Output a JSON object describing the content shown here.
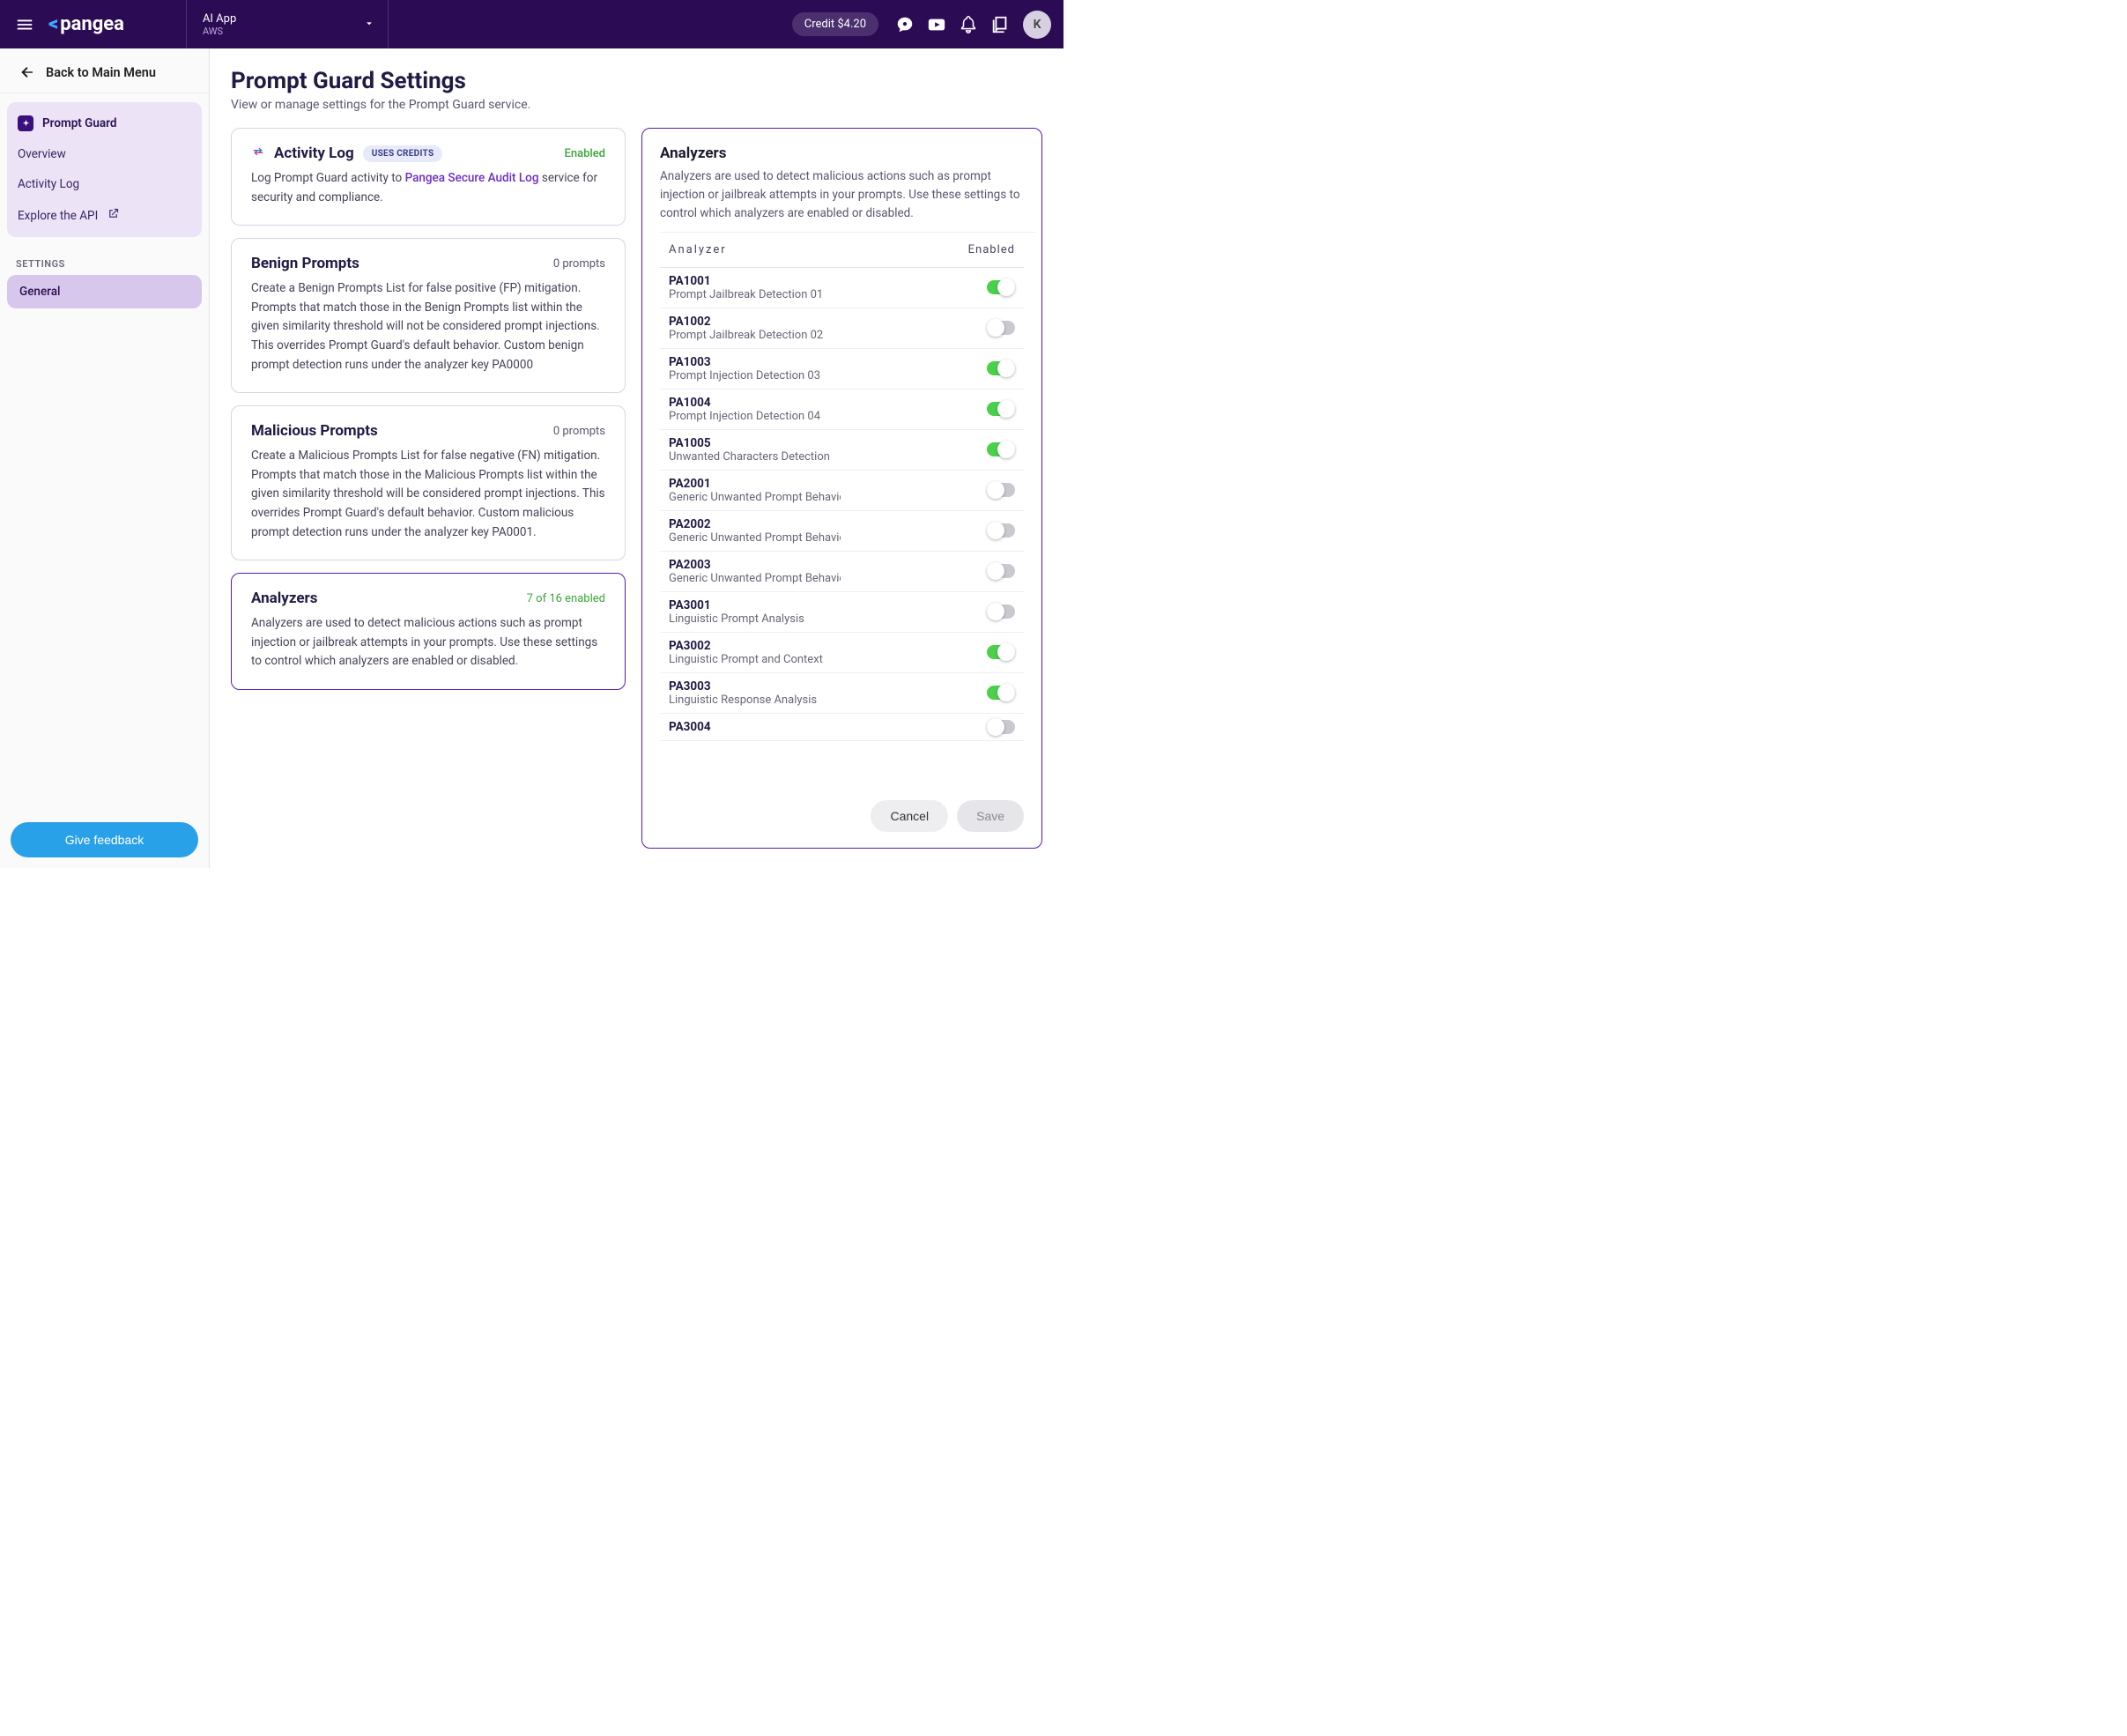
{
  "header": {
    "project_name": "AI App",
    "project_sub": "AWS",
    "credit": "Credit $4.20",
    "avatar": "K"
  },
  "sidebar": {
    "back": "Back to Main Menu",
    "group_header": "Prompt Guard",
    "items": [
      "Overview",
      "Activity Log",
      "Explore the API"
    ],
    "settings_label": "SETTINGS",
    "settings_item": "General",
    "feedback": "Give feedback"
  },
  "page": {
    "title": "Prompt Guard Settings",
    "subtitle": "View or manage settings for the Prompt Guard service."
  },
  "cards": {
    "activity": {
      "title": "Activity Log",
      "badge": "USES CREDITS",
      "status": "Enabled",
      "desc_pre": "Log Prompt Guard activity to ",
      "desc_link": "Pangea Secure Audit Log",
      "desc_post": " service for security and compliance."
    },
    "benign": {
      "title": "Benign Prompts",
      "count": "0 prompts",
      "desc": "Create a Benign Prompts List for false positive (FP) mitigation. Prompts that match those in the Benign Prompts list within the given similarity threshold will not be considered prompt injections. This overrides Prompt Guard's default behavior. Custom benign prompt detection runs under the analyzer key PA0000"
    },
    "malicious": {
      "title": "Malicious Prompts",
      "count": "0 prompts",
      "desc": "Create a Malicious Prompts List for false negative (FN) mitigation. Prompts that match those in the Malicious Prompts list within the given similarity threshold will be considered prompt injections. This overrides Prompt Guard's default behavior. Custom malicious prompt detection runs under the analyzer key PA0001."
    },
    "analyzers": {
      "title": "Analyzers",
      "count": "7 of 16 enabled",
      "desc": "Analyzers are used to detect malicious actions such as prompt injection or jailbreak attempts in your prompts. Use these settings to control which analyzers are enabled or disabled."
    }
  },
  "panel": {
    "title": "Analyzers",
    "desc": "Analyzers are used to detect malicious actions such as prompt injection or jailbreak attempts in your prompts. Use these settings to control which analyzers are enabled or disabled.",
    "col_a": "Analyzer",
    "col_b": "Enabled",
    "cancel": "Cancel",
    "save": "Save",
    "rows": [
      {
        "id": "PA1001",
        "name": "Prompt Jailbreak Detection 01",
        "on": true
      },
      {
        "id": "PA1002",
        "name": "Prompt Jailbreak Detection 02",
        "on": false
      },
      {
        "id": "PA1003",
        "name": "Prompt Injection Detection 03",
        "on": true
      },
      {
        "id": "PA1004",
        "name": "Prompt Injection Detection 04",
        "on": true
      },
      {
        "id": "PA1005",
        "name": "Unwanted Characters Detection",
        "on": true
      },
      {
        "id": "PA2001",
        "name": "Generic Unwanted Prompt Behavior",
        "on": false
      },
      {
        "id": "PA2002",
        "name": "Generic Unwanted Prompt Behavior",
        "on": false
      },
      {
        "id": "PA2003",
        "name": "Generic Unwanted Prompt Behavior",
        "on": false
      },
      {
        "id": "PA3001",
        "name": "Linguistic Prompt Analysis",
        "on": false
      },
      {
        "id": "PA3002",
        "name": "Linguistic Prompt and Context",
        "on": true
      },
      {
        "id": "PA3003",
        "name": "Linguistic Response Analysis",
        "on": true
      },
      {
        "id": "PA3004",
        "name": "",
        "on": false
      }
    ]
  }
}
